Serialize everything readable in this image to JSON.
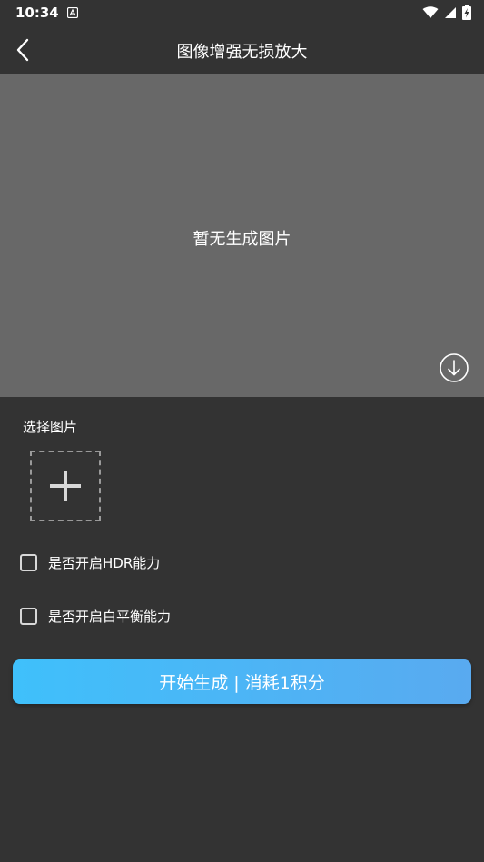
{
  "status_bar": {
    "time": "10:34",
    "notification_icon": "a-notification-icon",
    "icons": [
      "wifi-icon",
      "signal-icon",
      "battery-charging-icon"
    ]
  },
  "app_bar": {
    "title": "图像增强无损放大",
    "back_icon": "chevron-left-icon"
  },
  "preview": {
    "empty_text": "暂无生成图片",
    "download_icon": "download-circle-icon"
  },
  "select_image": {
    "label": "选择图片",
    "add_icon": "plus-icon"
  },
  "options": [
    {
      "label": "是否开启HDR能力",
      "checked": false
    },
    {
      "label": "是否开启白平衡能力",
      "checked": false
    }
  ],
  "start_button": {
    "label": "开始生成 | 消耗1积分"
  },
  "colors": {
    "background": "#333333",
    "preview_bg": "#686868",
    "button_gradient_start": "#3fc0fb",
    "button_gradient_end": "#59aaf0",
    "text": "#ffffff"
  }
}
